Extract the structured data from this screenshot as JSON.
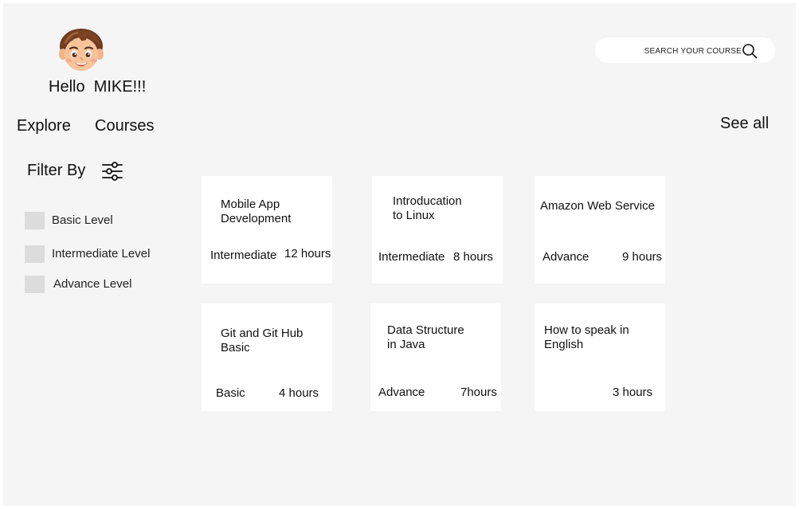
{
  "header": {
    "greeting": "Hello  MIKE!!!",
    "search": {
      "placeholder": "SEARCH YOUR COURSE"
    }
  },
  "nav": {
    "explore": "Explore",
    "courses": "Courses",
    "see_all": "See all"
  },
  "filter": {
    "title": "Filter By",
    "options": [
      {
        "label": "Basic Level"
      },
      {
        "label": "Intermediate Level"
      },
      {
        "label": "Advance Level"
      }
    ]
  },
  "courses": [
    {
      "title": "Mobile App\nDevelopment",
      "level": "Intermediate",
      "duration": "12 hours"
    },
    {
      "title": "Introducation\nto Linux",
      "level": "Intermediate",
      "duration": "8 hours"
    },
    {
      "title": "Amazon Web Service",
      "level": "Advance",
      "duration": "9 hours"
    },
    {
      "title": "Git and Git Hub\nBasic",
      "level": "Basic",
      "duration": "4 hours"
    },
    {
      "title": "Data Structure\nin Java",
      "level": "Advance",
      "duration": "7hours"
    },
    {
      "title": "How to speak in\nEnglish",
      "level": "",
      "duration": "3 hours"
    }
  ],
  "icons": {
    "avatar": "boy-avatar",
    "search": "search-icon",
    "filter": "sliders-icon"
  }
}
